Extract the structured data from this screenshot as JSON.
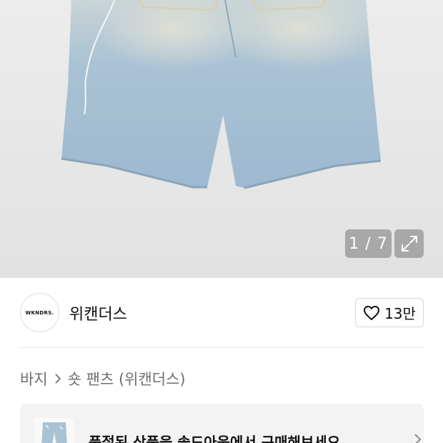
{
  "gallery": {
    "counter": "1 / 7",
    "expand_icon": "expand-icon"
  },
  "shop": {
    "logo_text": "WKNDRS.",
    "name": "위캔더스",
    "likes": "13만",
    "like_icon": "heart-icon"
  },
  "breadcrumb": {
    "items": [
      "바지",
      "숏 팬츠 (위캔더스)"
    ],
    "separator_icon": "chevron-right-icon"
  },
  "banner": {
    "text": "품절된 상품을 솔드아웃에서 구매해보세요",
    "chevron_icon": "chevron-right-icon"
  }
}
